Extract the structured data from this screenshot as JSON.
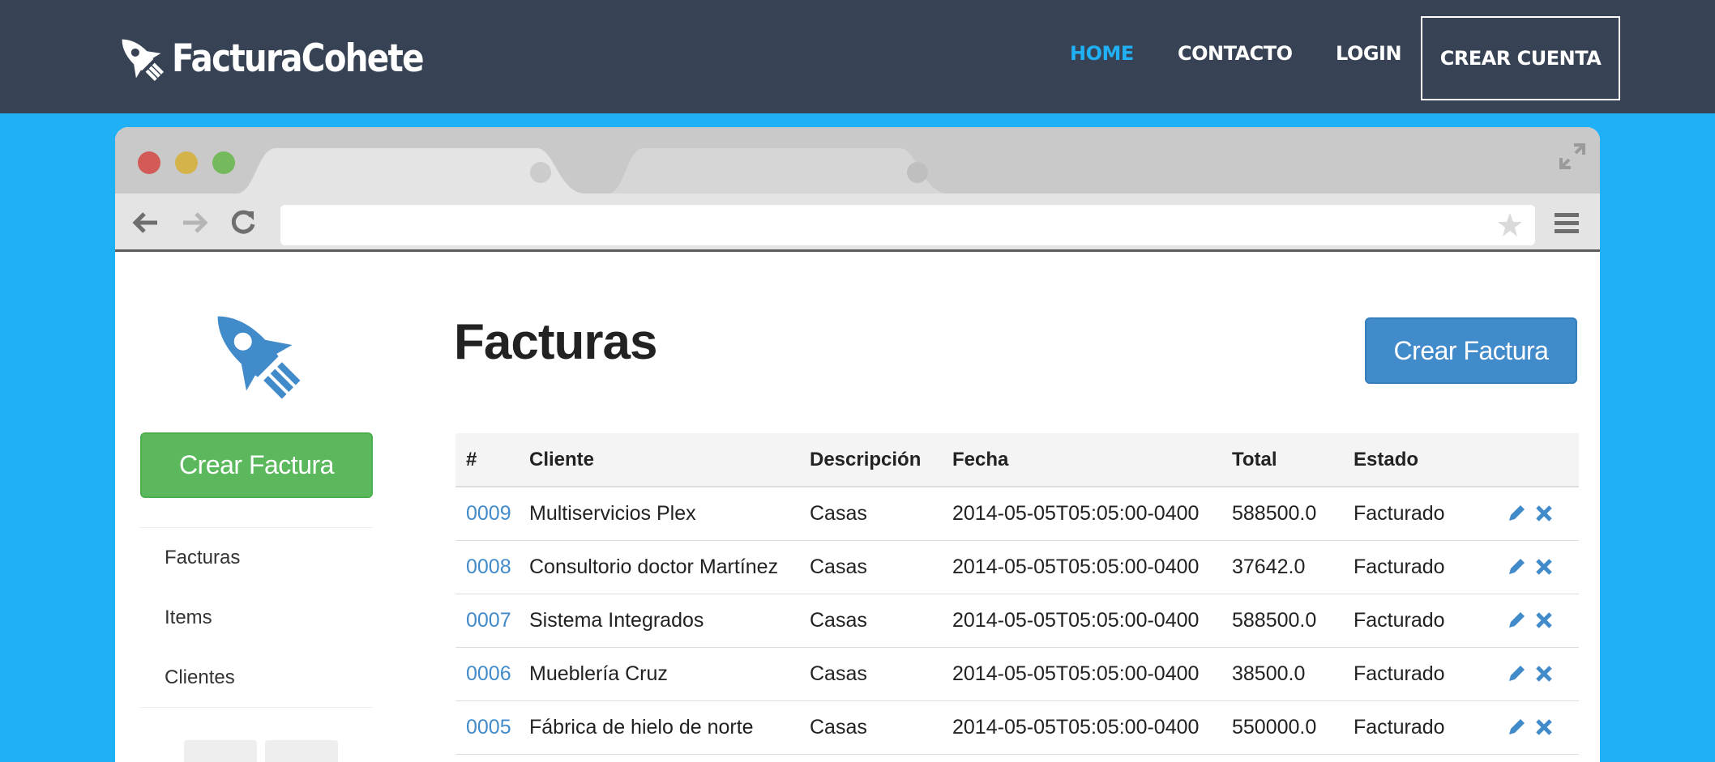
{
  "brand": {
    "name": "FacturaCohete",
    "accent": "#1fb0f5",
    "nav_bg": "#374354"
  },
  "nav": {
    "items": [
      {
        "label": "HOME",
        "active": true
      },
      {
        "label": "CONTACTO",
        "active": false
      },
      {
        "label": "LOGIN",
        "active": false
      }
    ],
    "cta": "CREAR CUENTA"
  },
  "app": {
    "sidebar": {
      "button": "Crear Factura",
      "button_color": "#5cb85c",
      "items": [
        "Facturas",
        "Items",
        "Clientes"
      ]
    },
    "main": {
      "title": "Facturas",
      "button": "Crear Factura",
      "button_color": "#428bca"
    },
    "table": {
      "headers": [
        "#",
        "Cliente",
        "Descripción",
        "Fecha",
        "Total",
        "Estado"
      ],
      "rows": [
        {
          "id": "0009",
          "cliente": "Multiservicios Plex",
          "descripcion": "Casas",
          "fecha": "2014-05-05T05:05:00-0400",
          "total": "588500.0",
          "estado": "Facturado"
        },
        {
          "id": "0008",
          "cliente": "Consultorio doctor Martínez",
          "descripcion": "Casas",
          "fecha": "2014-05-05T05:05:00-0400",
          "total": "37642.0",
          "estado": "Facturado"
        },
        {
          "id": "0007",
          "cliente": "Sistema Integrados",
          "descripcion": "Casas",
          "fecha": "2014-05-05T05:05:00-0400",
          "total": "588500.0",
          "estado": "Facturado"
        },
        {
          "id": "0006",
          "cliente": "Mueblería Cruz",
          "descripcion": "Casas",
          "fecha": "2014-05-05T05:05:00-0400",
          "total": "38500.0",
          "estado": "Facturado"
        },
        {
          "id": "0005",
          "cliente": "Fábrica de hielo de norte",
          "descripcion": "Casas",
          "fecha": "2014-05-05T05:05:00-0400",
          "total": "550000.0",
          "estado": "Facturado"
        }
      ],
      "row_actions": [
        "pencil-icon",
        "times-icon"
      ]
    }
  },
  "icons": {
    "logo": "rocket-icon",
    "sidebar_logo": "rocket-icon",
    "browser": [
      "back-arrow-icon",
      "forward-arrow-icon",
      "reload-icon",
      "star-icon",
      "menu-icon",
      "expand-icon"
    ],
    "social": [
      "twitter-icon",
      "github-icon"
    ]
  }
}
